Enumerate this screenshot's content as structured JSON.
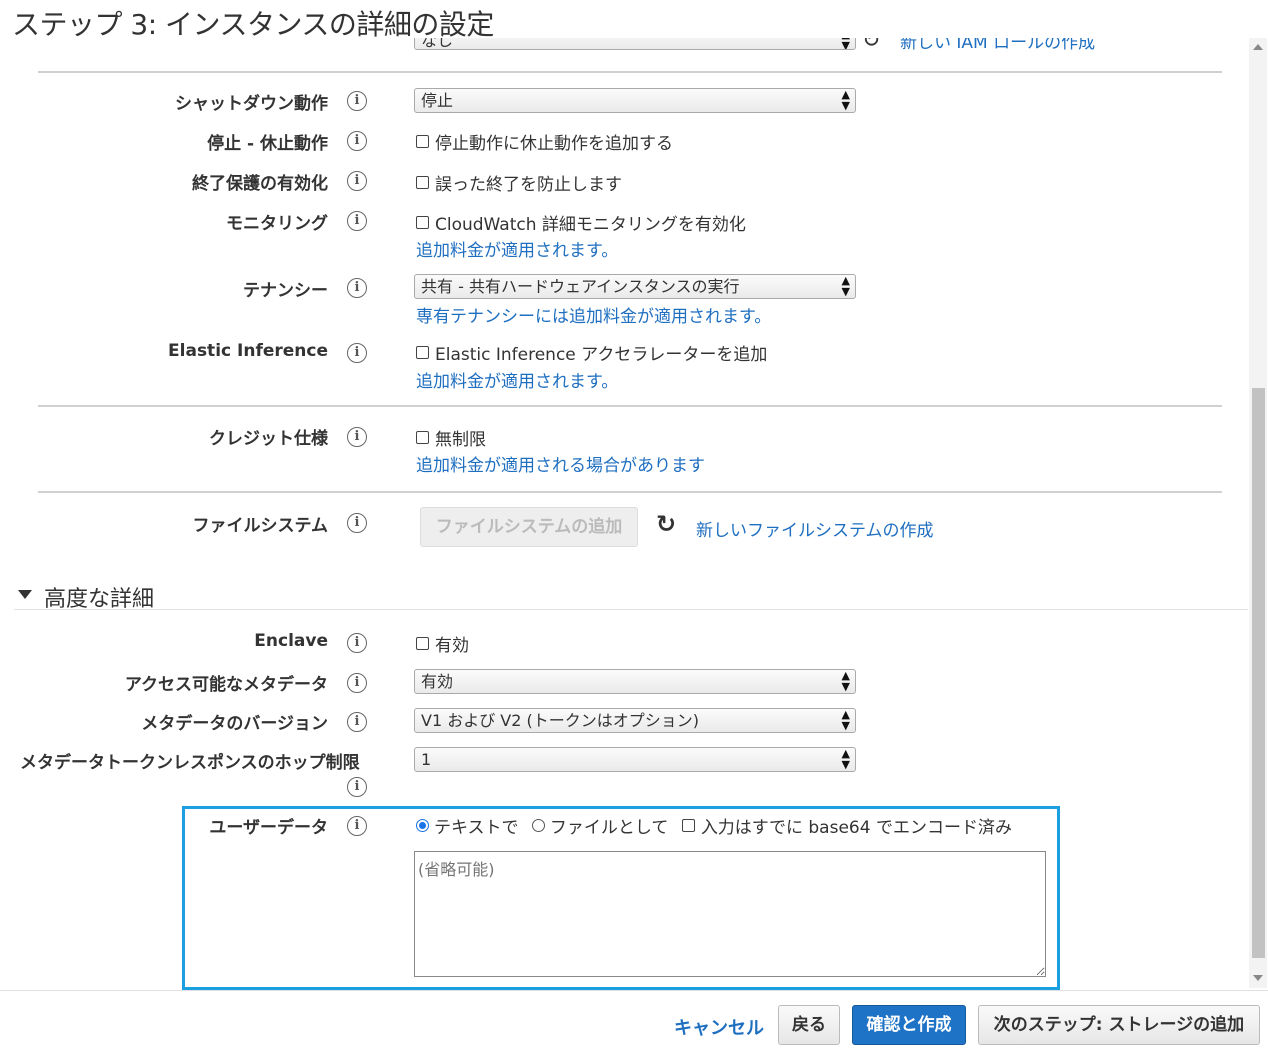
{
  "page": {
    "title": "ステップ 3: インスタンスの詳細の設定"
  },
  "top_partial": {
    "select_value": "なし",
    "link": "新しい IAM ロールの作成"
  },
  "shutdown": {
    "label": "シャットダウン動作",
    "value": "停止"
  },
  "stop_hibernate": {
    "label": "停止 - 休止動作",
    "checkbox": "停止動作に休止動作を追加する"
  },
  "termination": {
    "label": "終了保護の有効化",
    "checkbox": "誤った終了を防止します"
  },
  "monitoring": {
    "label": "モニタリング",
    "checkbox": "CloudWatch 詳細モニタリングを有効化",
    "note": "追加料金が適用されます。"
  },
  "tenancy": {
    "label": "テナンシー",
    "value": "共有 - 共有ハードウェアインスタンスの実行",
    "note": "専有テナンシーには追加料金が適用されます。"
  },
  "elastic_inference": {
    "label": "Elastic Inference",
    "checkbox": "Elastic Inference アクセラレーターを追加",
    "note": "追加料金が適用されます。"
  },
  "credit": {
    "label": "クレジット仕様",
    "checkbox": "無制限",
    "note": "追加料金が適用される場合があります"
  },
  "filesystem": {
    "label": "ファイルシステム",
    "add_button": "ファイルシステムの追加",
    "create_link": "新しいファイルシステムの作成"
  },
  "advanced": {
    "title": "高度な詳細"
  },
  "enclave": {
    "label": "Enclave",
    "checkbox": "有効"
  },
  "metadata_access": {
    "label": "アクセス可能なメタデータ",
    "value": "有効"
  },
  "metadata_version": {
    "label": "メタデータのバージョン",
    "value": "V1 および V2 (トークンはオプション)"
  },
  "hop_limit": {
    "label": "メタデータトークンレスポンスのホップ制限",
    "value": "1"
  },
  "user_data": {
    "label": "ユーザーデータ",
    "radio_text": "テキストで",
    "radio_file": "ファイルとして",
    "checkbox_base64": "入力はすでに base64 でエンコード済み",
    "placeholder": "(省略可能)"
  },
  "footer": {
    "cancel": "キャンセル",
    "back": "戻る",
    "review_launch": "確認と作成",
    "next": "次のステップ: ストレージの追加"
  },
  "colors": {
    "link": "#1f6fc1",
    "primary_button": "#1e73c7",
    "highlight_border": "#1aa0e0"
  }
}
